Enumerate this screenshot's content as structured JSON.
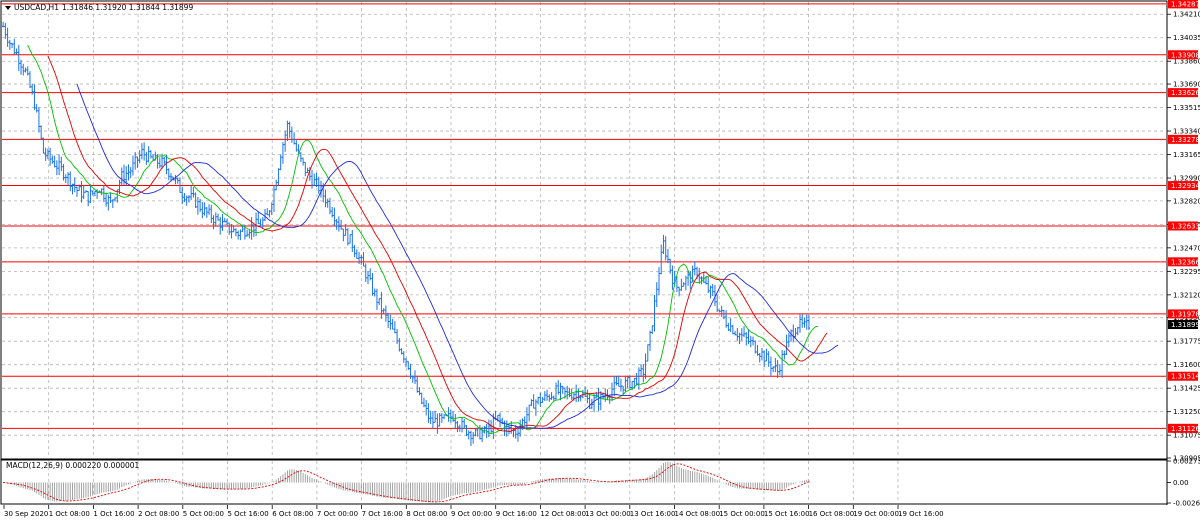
{
  "chart_data": [
    {
      "type": "line",
      "symbol": "USDCAD,H1",
      "ohlc_header": "1.31846 1.31920 1.31844 1.31899",
      "current_price": "1.31899",
      "ylim": [
        1.30905,
        1.34301
      ],
      "y_ticks": [
        "1.34210",
        "1.34035",
        "1.33860",
        "1.33690",
        "1.33515",
        "1.33340",
        "1.33165",
        "1.32990",
        "1.32820",
        "1.32645",
        "1.32470",
        "1.32295",
        "1.32120",
        "1.31950",
        "1.31775",
        "1.31600",
        "1.31425",
        "1.31250",
        "1.31075",
        "1.30905"
      ],
      "x_ticks": [
        "30 Sep 2020",
        "1 Oct 08:00",
        "1 Oct 16:00",
        "2 Oct 08:00",
        "5 Oct 00:00",
        "5 Oct 16:00",
        "6 Oct 08:00",
        "7 Oct 00:00",
        "7 Oct 16:00",
        "8 Oct 08:00",
        "9 Oct 00:00",
        "9 Oct 16:00",
        "12 Oct 08:00",
        "13 Oct 00:00",
        "13 Oct 16:00",
        "14 Oct 08:00",
        "15 Oct 00:00",
        "15 Oct 16:00",
        "16 Oct 08:00",
        "19 Oct 00:00",
        "19 Oct 16:00"
      ],
      "levels": [
        "1.34287",
        "1.33908",
        "1.33626",
        "1.33278",
        "1.32934",
        "1.32633",
        "1.32366",
        "1.31978",
        "1.31514",
        "1.31126"
      ],
      "price_anchors": [
        [
          0,
          1.3412
        ],
        [
          3,
          1.34
        ],
        [
          6,
          1.3392
        ],
        [
          10,
          1.3378
        ],
        [
          14,
          1.3355
        ],
        [
          18,
          1.3318
        ],
        [
          23,
          1.331
        ],
        [
          28,
          1.3302
        ],
        [
          33,
          1.329
        ],
        [
          38,
          1.3285
        ],
        [
          43,
          1.3292
        ],
        [
          48,
          1.328
        ],
        [
          53,
          1.33
        ],
        [
          57,
          1.3305
        ],
        [
          62,
          1.3318
        ],
        [
          67,
          1.3312
        ],
        [
          71,
          1.331
        ],
        [
          75,
          1.3302
        ],
        [
          80,
          1.3288
        ],
        [
          85,
          1.3283
        ],
        [
          90,
          1.3274
        ],
        [
          95,
          1.3268
        ],
        [
          100,
          1.3262
        ],
        [
          105,
          1.3258
        ],
        [
          110,
          1.3262
        ],
        [
          115,
          1.3265
        ],
        [
          118,
          1.327
        ],
        [
          121,
          1.329
        ],
        [
          124,
          1.3318
        ],
        [
          127,
          1.3338
        ],
        [
          129,
          1.333
        ],
        [
          132,
          1.3315
        ],
        [
          135,
          1.3305
        ],
        [
          138,
          1.3298
        ],
        [
          141,
          1.3292
        ],
        [
          146,
          1.3278
        ],
        [
          151,
          1.3262
        ],
        [
          156,
          1.325
        ],
        [
          161,
          1.3232
        ],
        [
          166,
          1.3212
        ],
        [
          171,
          1.3195
        ],
        [
          176,
          1.3178
        ],
        [
          181,
          1.316
        ],
        [
          186,
          1.3135
        ],
        [
          191,
          1.3118
        ],
        [
          196,
          1.3118
        ],
        [
          201,
          1.3122
        ],
        [
          206,
          1.3112
        ],
        [
          211,
          1.3108
        ],
        [
          216,
          1.311
        ],
        [
          221,
          1.312
        ],
        [
          225,
          1.3112
        ],
        [
          229,
          1.311
        ],
        [
          233,
          1.312
        ],
        [
          237,
          1.3132
        ],
        [
          242,
          1.3135
        ],
        [
          247,
          1.314
        ],
        [
          252,
          1.3138
        ],
        [
          257,
          1.314
        ],
        [
          262,
          1.3132
        ],
        [
          267,
          1.3135
        ],
        [
          272,
          1.3142
        ],
        [
          277,
          1.3145
        ],
        [
          282,
          1.3148
        ],
        [
          286,
          1.3155
        ],
        [
          289,
          1.318
        ],
        [
          291,
          1.3205
        ],
        [
          293,
          1.323
        ],
        [
          295,
          1.325
        ],
        [
          297,
          1.3238
        ],
        [
          299,
          1.3225
        ],
        [
          301,
          1.3218
        ],
        [
          304,
          1.3222
        ],
        [
          307,
          1.3225
        ],
        [
          310,
          1.323
        ],
        [
          313,
          1.322
        ],
        [
          317,
          1.3212
        ],
        [
          320,
          1.32
        ],
        [
          323,
          1.3192
        ],
        [
          327,
          1.3185
        ],
        [
          331,
          1.318
        ],
        [
          335,
          1.3175
        ],
        [
          339,
          1.3168
        ],
        [
          343,
          1.316
        ],
        [
          346,
          1.3155
        ],
        [
          349,
          1.317
        ],
        [
          352,
          1.3183
        ],
        [
          355,
          1.319
        ],
        [
          358,
          1.3188
        ],
        [
          360,
          1.319
        ]
      ]
    },
    {
      "type": "bar",
      "indicator_label": "MACD(12,26,9) 0.000220 0.000001",
      "ylim": [
        -0.002612,
        0.002739
      ],
      "y_ticks": [
        "0.002739",
        "0.00",
        "-0.002612"
      ]
    }
  ]
}
